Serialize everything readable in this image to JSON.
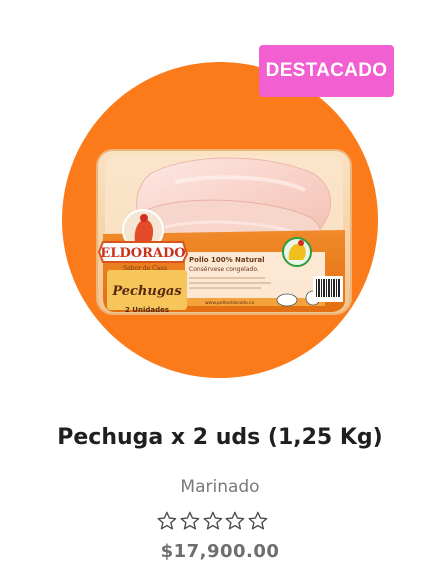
{
  "product": {
    "badge": "DESTACADO",
    "title": "Pechuga x 2 uds (1,25 Kg)",
    "category": "Marinado",
    "price": "$17,900.00",
    "rating": 0,
    "rating_max": 5
  },
  "packaging": {
    "brand": "ELDORADO",
    "slogan": "Sabor de Casa",
    "product_name": "Pechugas",
    "units": "2 Unidades",
    "claim": "Pollo 100% Natural",
    "storage": "Consérvese congelado.",
    "website": "www.polloeldorado.co"
  },
  "colors": {
    "circle": "#fb7a1a",
    "badge_bg": "#f15fd0",
    "title": "#1f1f1f",
    "category": "#7a7a7a",
    "price": "#6e6e6e"
  }
}
